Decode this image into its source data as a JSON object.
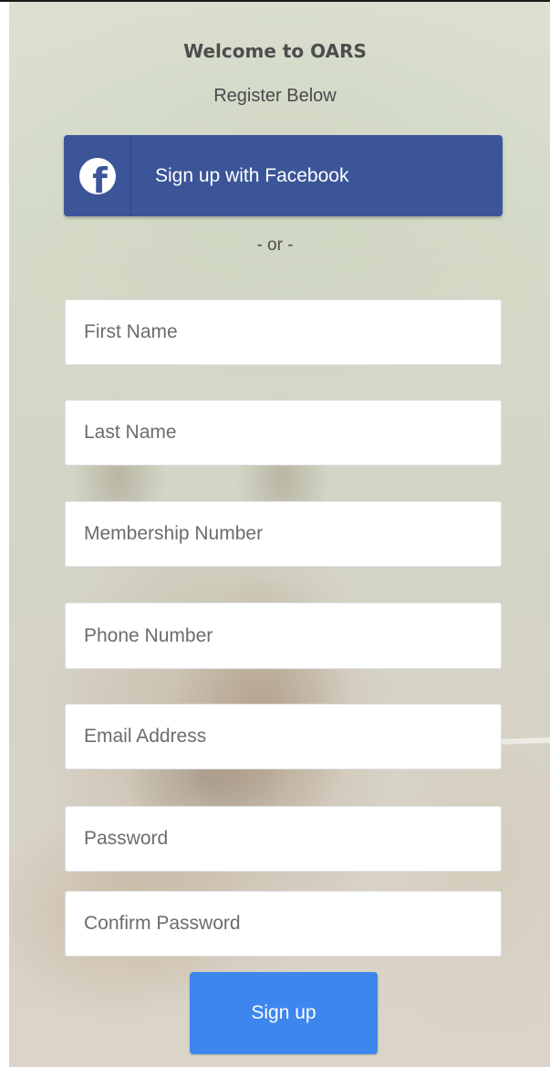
{
  "header": {
    "title": "Welcome to OARS",
    "subtitle": "Register Below"
  },
  "facebook": {
    "icon": "facebook-icon",
    "label": "Sign up with Facebook",
    "color": "#3b5598"
  },
  "divider": {
    "text": "- or -"
  },
  "fields": {
    "first_name": {
      "placeholder": "First Name",
      "value": ""
    },
    "last_name": {
      "placeholder": "Last Name",
      "value": ""
    },
    "membership_number": {
      "placeholder": "Membership Number",
      "value": ""
    },
    "phone_number": {
      "placeholder": "Phone Number",
      "value": ""
    },
    "email_address": {
      "placeholder": "Email Address",
      "value": ""
    },
    "password": {
      "placeholder": "Password",
      "value": ""
    },
    "confirm_password": {
      "placeholder": "Confirm Password",
      "value": ""
    }
  },
  "submit": {
    "label": "Sign up",
    "color": "#3d86ee"
  }
}
